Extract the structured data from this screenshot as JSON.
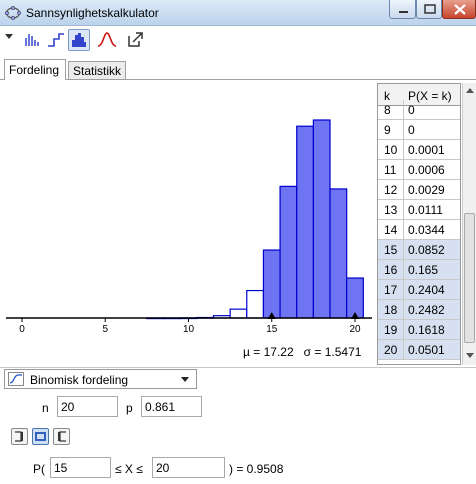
{
  "window": {
    "title": "Sannsynlighetskalkulator"
  },
  "tabs": [
    {
      "label": "Fordeling"
    },
    {
      "label": "Statistikk"
    }
  ],
  "chart_data": {
    "type": "bar",
    "x_ticks": [
      0,
      5,
      10,
      15,
      20
    ],
    "xlim": [
      0,
      20
    ],
    "k": [
      8,
      9,
      10,
      11,
      12,
      13,
      14,
      15,
      16,
      17,
      18,
      19,
      20
    ],
    "values": [
      0,
      0,
      0.0001,
      0.0006,
      0.0029,
      0.0111,
      0.0344,
      0.0852,
      0.165,
      0.2404,
      0.2482,
      0.1618,
      0.0501
    ],
    "highlight_range": [
      15,
      20
    ],
    "colors": {
      "selected": "#6f74f2",
      "unselected": "#ffffff",
      "edge": "#0000cc"
    }
  },
  "stats": {
    "mu": "µ = 17.22",
    "sigma": "σ = 1.5471"
  },
  "table": {
    "col_k": "k",
    "col_p": "P(X = k)",
    "rows": [
      {
        "k": "8",
        "p": "0"
      },
      {
        "k": "9",
        "p": "0"
      },
      {
        "k": "10",
        "p": "0.0001"
      },
      {
        "k": "11",
        "p": "0.0006"
      },
      {
        "k": "12",
        "p": "0.0029"
      },
      {
        "k": "13",
        "p": "0.0111"
      },
      {
        "k": "14",
        "p": "0.0344"
      },
      {
        "k": "15",
        "p": "0.0852"
      },
      {
        "k": "16",
        "p": "0.165"
      },
      {
        "k": "17",
        "p": "0.2404"
      },
      {
        "k": "18",
        "p": "0.2482"
      },
      {
        "k": "19",
        "p": "0.1618"
      },
      {
        "k": "20",
        "p": "0.0501"
      }
    ]
  },
  "distribution": {
    "selected": "Binomisk fordeling"
  },
  "params": {
    "n_label": "n",
    "n_value": "20",
    "p_label": "p",
    "p_value": "0.861"
  },
  "interval": {
    "prefix": "P(",
    "low": "15",
    "mid": "≤ X ≤",
    "high": "20",
    "result": ") =  0.9508"
  }
}
